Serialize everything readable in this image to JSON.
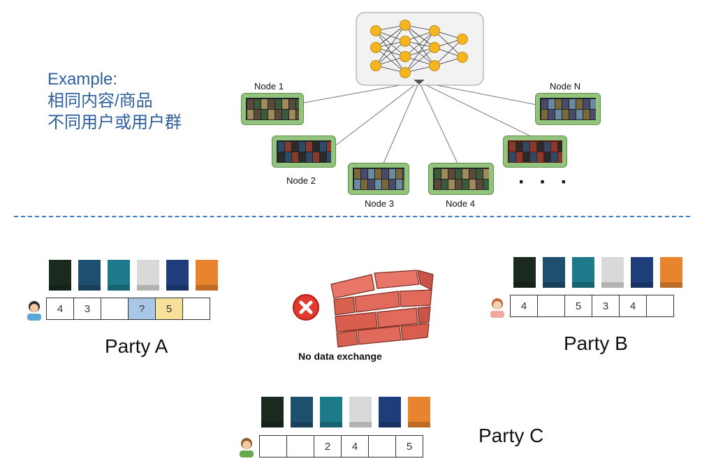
{
  "example": {
    "line1": "Example:",
    "line2": "相同内容/商品",
    "line3": "不同用户或用户群"
  },
  "nodes": {
    "node1": "Node 1",
    "node2": "Node 2",
    "node3": "Node 3",
    "node4": "Node 4",
    "nodeN": "Node N",
    "ellipsis": "· · ·"
  },
  "middle": {
    "no_data": "No data exchange"
  },
  "parties": {
    "a": {
      "label": "Party A",
      "ratings": [
        "4",
        "3",
        "",
        "?",
        "5",
        ""
      ]
    },
    "b": {
      "label": "Party B",
      "ratings": [
        "4",
        "",
        "5",
        "3",
        "4",
        ""
      ]
    },
    "c": {
      "label": "Party C",
      "ratings": [
        "",
        "",
        "2",
        "4",
        "",
        "5"
      ]
    }
  },
  "colors": {
    "unknown_cell": "#a9c8e8",
    "highlight_cell": "#f7e19a",
    "node_green": "#93c47d",
    "divider": "#3d7fc2",
    "example_text": "#2f5f9e"
  },
  "book_colors": [
    "#1b2a1f",
    "#1e4f6e",
    "#1c7a8a",
    "#d9d9d9",
    "#1f3d7a",
    "#e8842e"
  ]
}
